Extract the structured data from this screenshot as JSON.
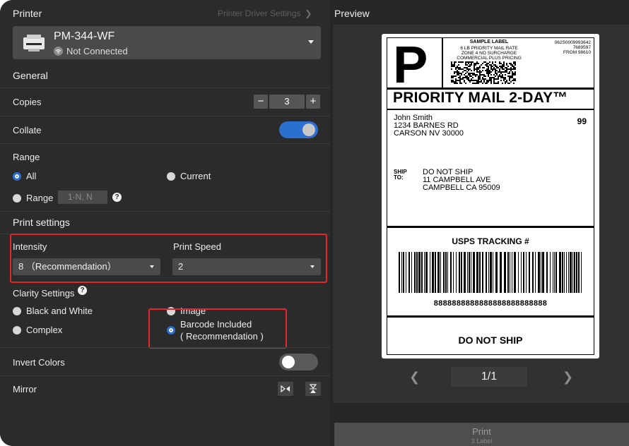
{
  "printer": {
    "header": "Printer",
    "driver_link": "Printer Driver Settings",
    "name": "PM-344-WF",
    "status": "Not Connected"
  },
  "general": {
    "title": "General",
    "copies_label": "Copies",
    "copies_value": "3",
    "collate_label": "Collate",
    "collate_on": true,
    "range_label": "Range",
    "range_all": "All",
    "range_current": "Current",
    "range_range": "Range",
    "range_placeholder": "1-N, N"
  },
  "print_settings": {
    "title": "Print settings",
    "intensity_label": "Intensity",
    "intensity_value": "8 （Recommendation）",
    "speed_label": "Print Speed",
    "speed_value": "2",
    "clarity_label": "Clarity Settings",
    "bw": "Black and White",
    "image": "Image",
    "complex": "Complex",
    "barcode_line1": "Barcode Included",
    "barcode_line2": "( Recommendation )",
    "invert_label": "Invert Colors",
    "invert_on": false,
    "mirror_label": "Mirror"
  },
  "preview": {
    "header": "Preview",
    "page": "1/1",
    "print_label": "Print",
    "print_sub": "3 Label",
    "label": {
      "letter": "P",
      "sample": "SAMPLE LABEL",
      "sample_lines": [
        "6 LB PRIORITY MAIL RATE",
        "ZONE 4 NO SURCHARGE",
        "COMMERCIAL PLUS PRICING"
      ],
      "right_info": [
        "062S0009993642",
        "7689597",
        "FROM 98610"
      ],
      "service": "PRIORITY MAIL 2-DAY™",
      "from_lines": [
        "John Smith",
        "1234 BARNES RD",
        "CARSON NV 30000"
      ],
      "code": "99",
      "ship_to_label": [
        "SHIP",
        "TO:"
      ],
      "to_lines": [
        "DO NOT SHIP",
        "11 CAMPBELL AVE",
        "CAMPBELL CA 95009"
      ],
      "tracking_label": "USPS TRACKING #",
      "tracking_digits": "8888888888888888888888888",
      "footer": "DO NOT SHIP"
    }
  },
  "colors": {
    "accent": "#2b6fd0",
    "highlight": "#e2262c",
    "panel": "#2b2b2b"
  },
  "icons": [
    "printer-icon",
    "wifi-icon",
    "chevron-right-icon",
    "chevron-down-icon",
    "help-icon",
    "mirror-horizontal-icon",
    "mirror-vertical-icon",
    "chevron-left-icon"
  ]
}
